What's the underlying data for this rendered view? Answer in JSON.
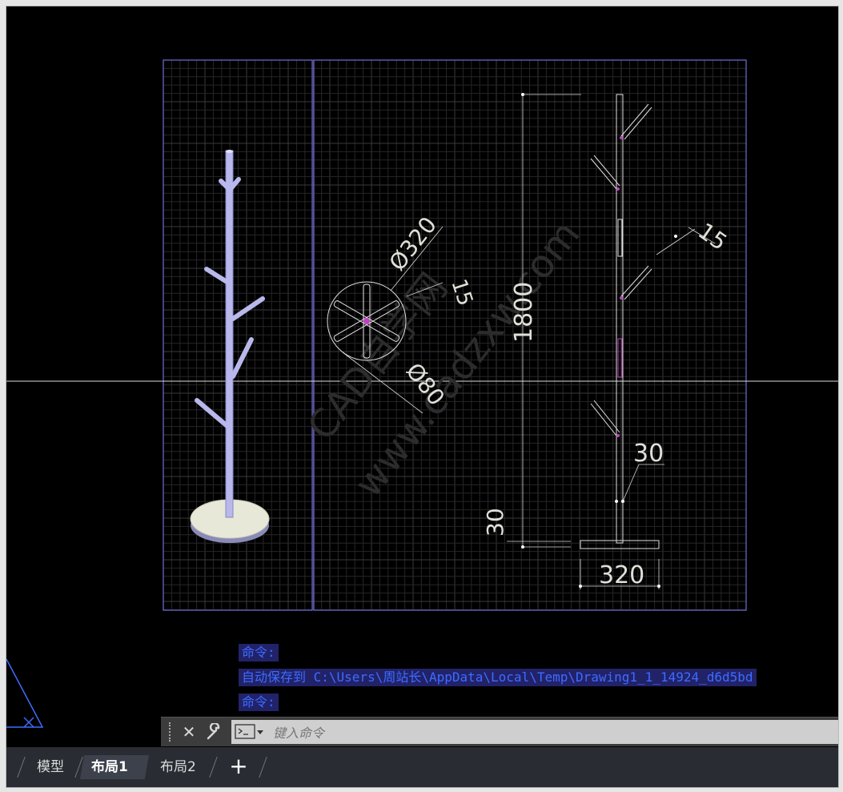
{
  "drawing": {
    "dims": {
      "d320": "Ø320",
      "d80": "Ø80",
      "t15_left": "15",
      "t15_right": "15",
      "h1800": "1800",
      "h30_left": "30",
      "h30_right": "30",
      "w320": "320"
    },
    "watermark": {
      "line1": "CAD自学网",
      "line2": "www.cadzxw.com"
    }
  },
  "command_history": [
    "命令:",
    "自动保存到 C:\\Users\\周站长\\AppData\\Local\\Temp\\Drawing1_1_14924_d6d5bd",
    "命令:"
  ],
  "command_line": {
    "placeholder": "键入命令",
    "close_icon": "close-icon",
    "customize_icon": "wrench-icon",
    "prompt_icon": "command-prompt-icon"
  },
  "tabs": [
    {
      "label": "模型",
      "active": false
    },
    {
      "label": "布局1",
      "active": true
    },
    {
      "label": "布局2",
      "active": false
    }
  ],
  "colors": {
    "canvas_bg": "#000000",
    "viewport_border": "#6f6fd8",
    "rack_fill": "#b8b8ec",
    "base_fill": "#e8e8d8",
    "command_text": "#3c6cff",
    "command_bg": "#222269",
    "tab_bar": "#292c33"
  }
}
